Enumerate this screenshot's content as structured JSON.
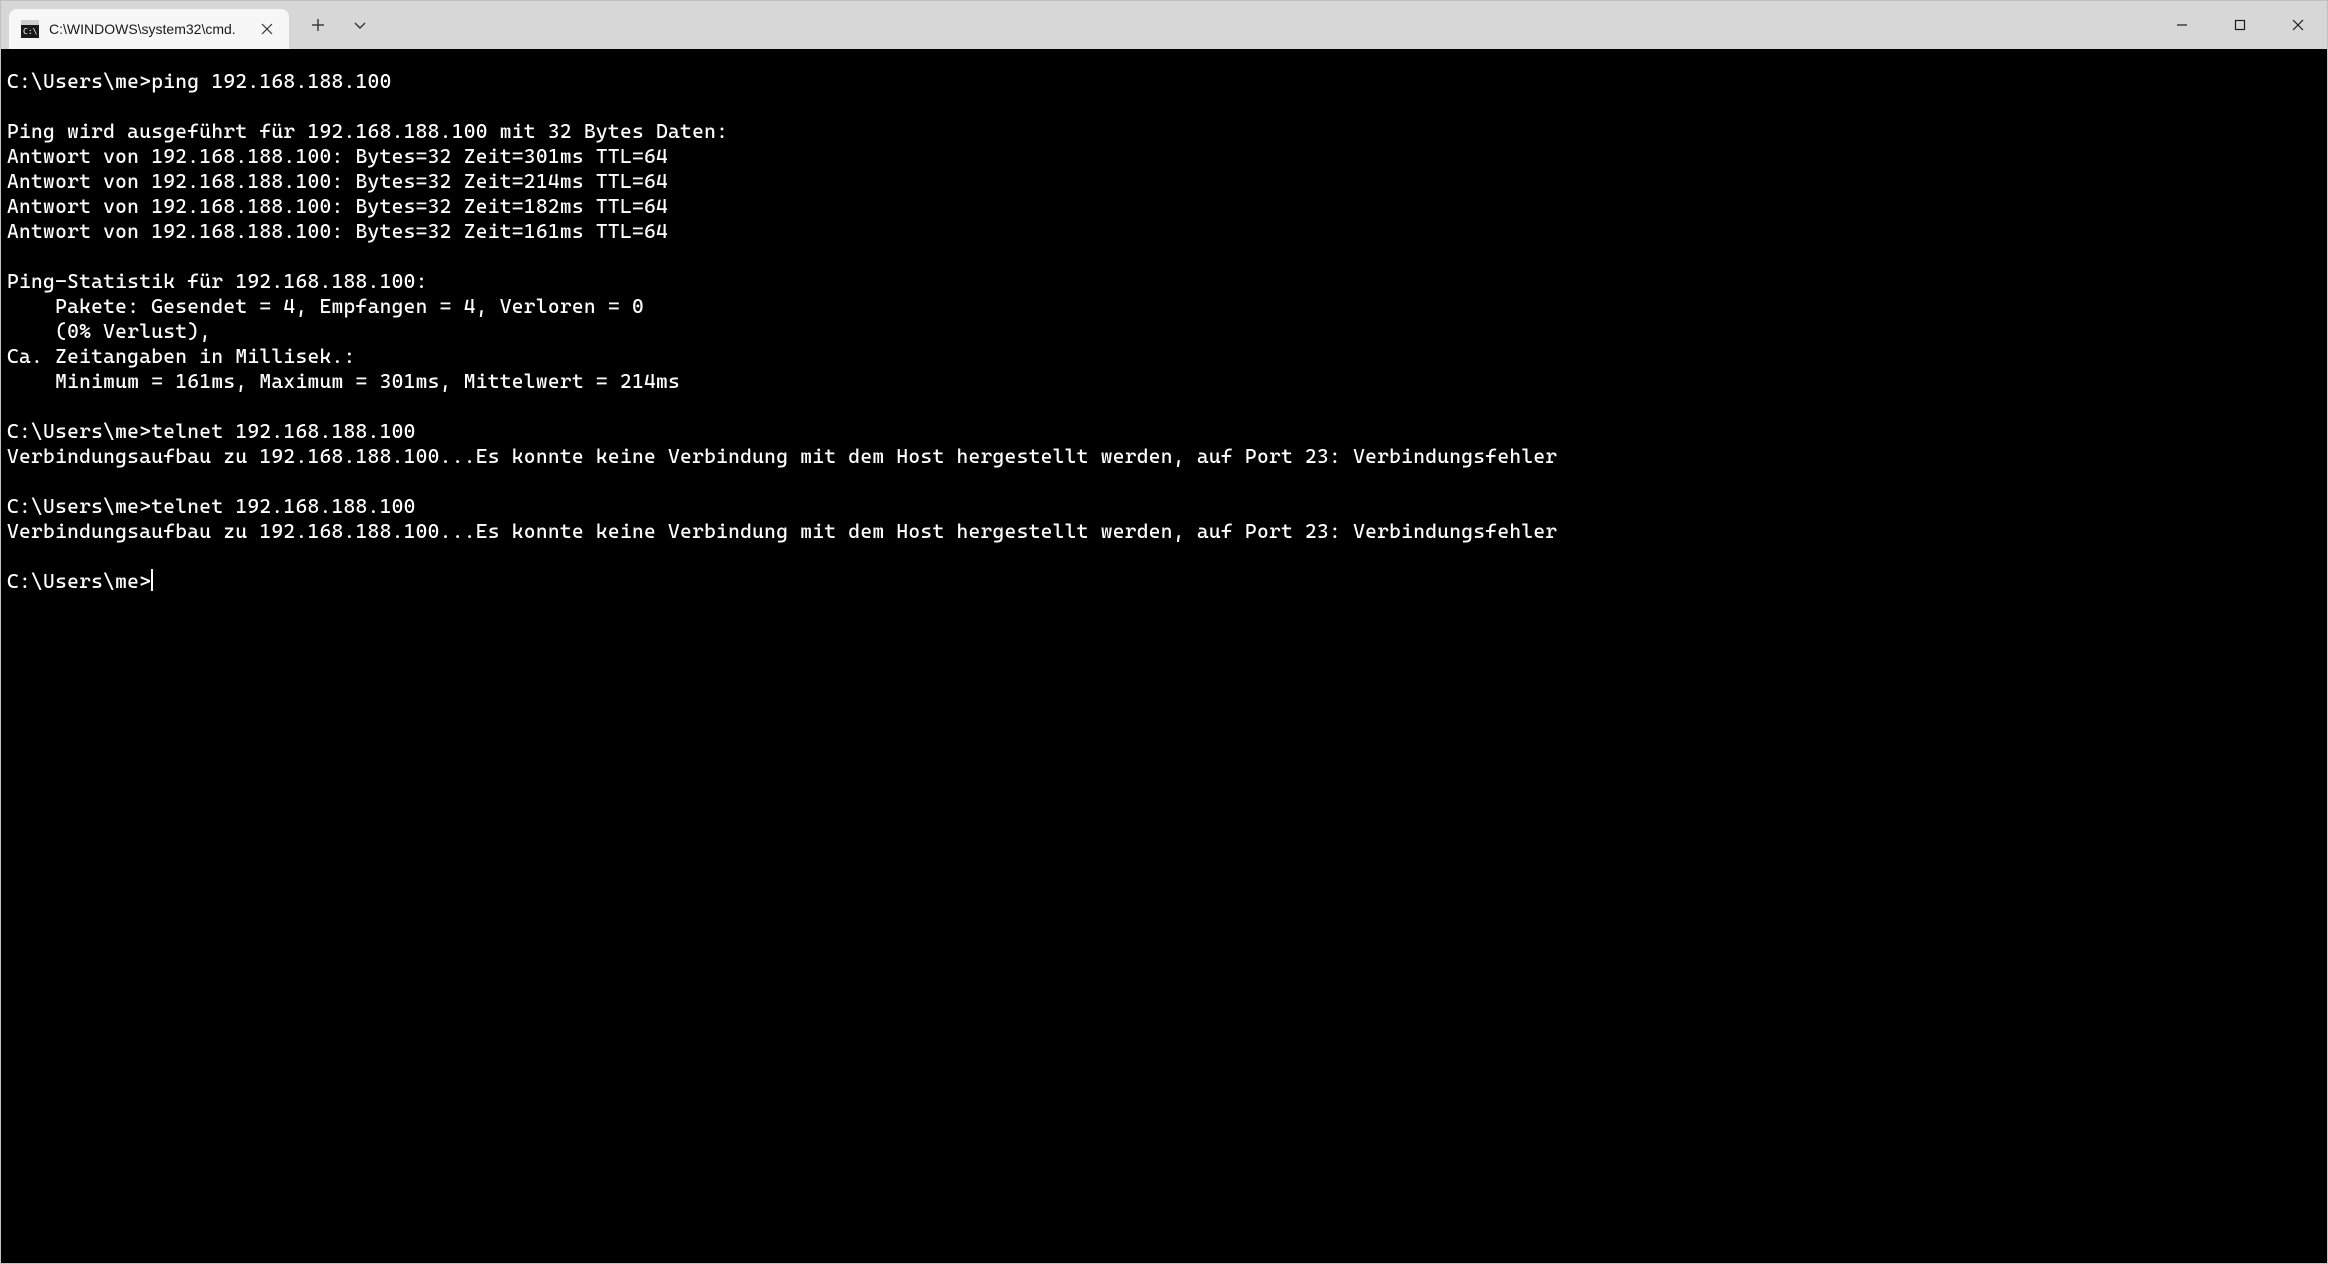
{
  "window": {
    "tab_title": "C:\\WINDOWS\\system32\\cmd."
  },
  "terminal": {
    "lines": [
      "C:\\Users\\me>ping 192.168.188.100",
      "",
      "Ping wird ausgeführt für 192.168.188.100 mit 32 Bytes Daten:",
      "Antwort von 192.168.188.100: Bytes=32 Zeit=301ms TTL=64",
      "Antwort von 192.168.188.100: Bytes=32 Zeit=214ms TTL=64",
      "Antwort von 192.168.188.100: Bytes=32 Zeit=182ms TTL=64",
      "Antwort von 192.168.188.100: Bytes=32 Zeit=161ms TTL=64",
      "",
      "Ping-Statistik für 192.168.188.100:",
      "    Pakete: Gesendet = 4, Empfangen = 4, Verloren = 0",
      "    (0% Verlust),",
      "Ca. Zeitangaben in Millisek.:",
      "    Minimum = 161ms, Maximum = 301ms, Mittelwert = 214ms",
      "",
      "C:\\Users\\me>telnet 192.168.188.100",
      "Verbindungsaufbau zu 192.168.188.100...Es konnte keine Verbindung mit dem Host hergestellt werden, auf Port 23: Verbindungsfehler",
      "",
      "C:\\Users\\me>telnet 192.168.188.100",
      "Verbindungsaufbau zu 192.168.188.100...Es konnte keine Verbindung mit dem Host hergestellt werden, auf Port 23: Verbindungsfehler",
      ""
    ],
    "prompt": "C:\\Users\\me>"
  }
}
